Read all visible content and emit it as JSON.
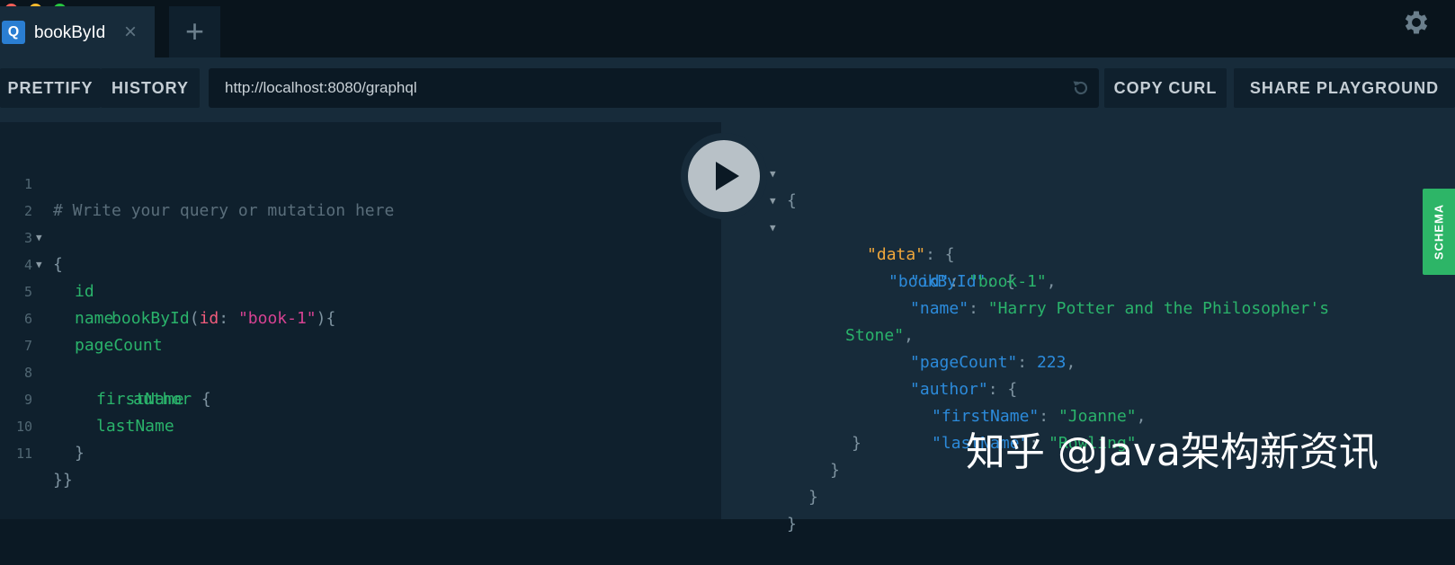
{
  "window": {
    "traffic_lights": [
      "close",
      "minimize",
      "maximize"
    ]
  },
  "tabs": [
    {
      "badge": "Q",
      "title": "bookById",
      "close": "×"
    }
  ],
  "new_tab": "+",
  "toolbar": {
    "prettify": "PRETTIFY",
    "history": "HISTORY",
    "url": "http://localhost:8080/graphql",
    "copy_curl": "COPY CURL",
    "share_playground": "SHARE PLAYGROUND"
  },
  "schema_tab": "SCHEMA",
  "query_editor": {
    "line_numbers": [
      "1",
      "2",
      "3",
      "4",
      "5",
      "6",
      "7",
      "8",
      "9",
      "10",
      "11"
    ],
    "comment": "# Write your query or mutation here",
    "open_brace": "{",
    "query_field": "bookById",
    "paren_open": "(",
    "arg_name": "id",
    "colon": ":",
    "arg_value": "\"book-1\"",
    "paren_close_brace": "){",
    "fields": [
      "id",
      "name",
      "pageCount"
    ],
    "author_field": "author",
    "author_brace": "{",
    "author_fields": [
      "firstName",
      "lastName"
    ],
    "close_inner": "}",
    "close_outer": "}}"
  },
  "result": {
    "open": "{",
    "data_key": "\"data\"",
    "book_key": "\"bookById\"",
    "id_key": "\"id\"",
    "id_value": "\"book-1\"",
    "name_key": "\"name\"",
    "name_value_1": "\"Harry Potter and the Philosopher's",
    "name_value_2": "Stone\"",
    "pagecount_key": "\"pageCount\"",
    "pagecount_value": "223",
    "author_key": "\"author\"",
    "firstname_key": "\"firstName\"",
    "firstname_value": "\"Joanne\"",
    "lastname_key": "\"lastName\"",
    "lastname_value": "\"Rowling\"",
    "colon": ": ",
    "comma": ",",
    "brace_open": "{",
    "brace_close": "}"
  },
  "watermark": "知乎 @Java架构新资讯",
  "colors": {
    "background": "#0b1924",
    "panel": "#172b3a",
    "schema_green": "#2db567",
    "field_green": "#2ab36b",
    "key_blue": "#2c8bdb",
    "data_orange": "#f0a73b",
    "string_pink": "#d64292"
  },
  "icons": {
    "settings": "gear-icon",
    "reload": "reload-icon",
    "run": "play-icon"
  }
}
